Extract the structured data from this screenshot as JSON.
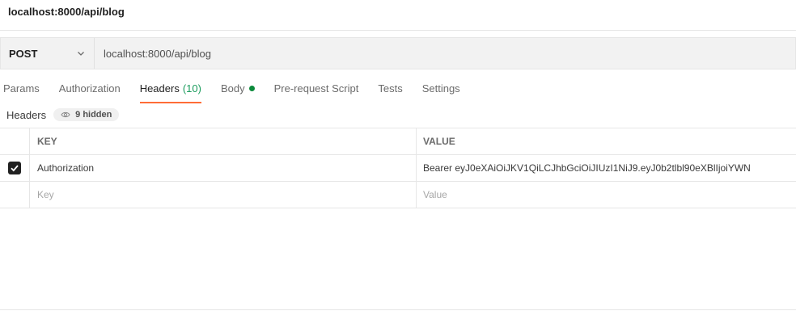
{
  "request": {
    "title": "localhost:8000/api/blog",
    "method": "POST",
    "url": "localhost:8000/api/blog"
  },
  "tabs": [
    {
      "label": "Params"
    },
    {
      "label": "Authorization"
    },
    {
      "label": "Headers",
      "count": "(10)"
    },
    {
      "label": "Body"
    },
    {
      "label": "Pre-request Script"
    },
    {
      "label": "Tests"
    },
    {
      "label": "Settings"
    }
  ],
  "headers_section": {
    "label": "Headers",
    "hidden_count": "9 hidden"
  },
  "table": {
    "col_key": "KEY",
    "col_value": "VALUE",
    "rows": [
      {
        "key": "Authorization",
        "value": "Bearer eyJ0eXAiOiJKV1QiLCJhbGciOiJIUzI1NiJ9.eyJ0b2tlbl90eXBlIjoiYWN",
        "checked": true
      }
    ],
    "key_placeholder": "Key",
    "value_placeholder": "Value"
  },
  "colors": {
    "active_tab_underline": "#ff6c37",
    "count_green": "#1b9c5d",
    "body_dot": "#0c8a3b"
  },
  "icons": {
    "method_dropdown": "chevron-down-icon",
    "hidden_headers": "eye-icon",
    "row_checkbox": "checkmark-icon"
  }
}
